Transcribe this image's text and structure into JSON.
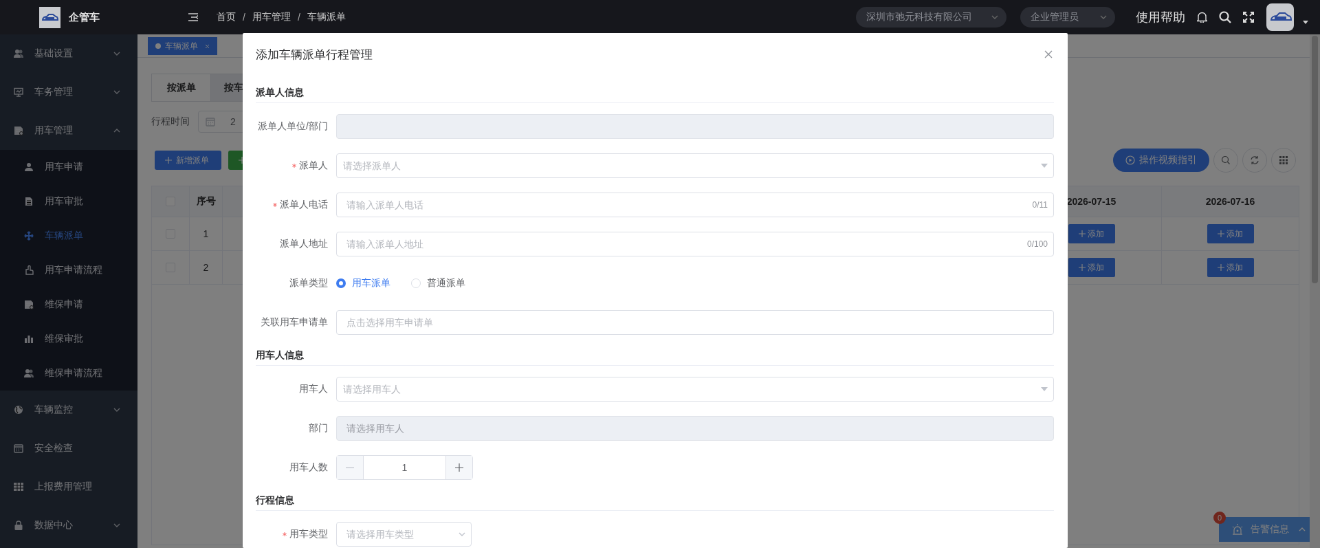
{
  "topbar": {
    "app_name": "企管车",
    "breadcrumb": {
      "separator": "/",
      "items": [
        "首页",
        "用车管理",
        "车辆派单"
      ]
    },
    "company": "深圳市弛元科技有限公司",
    "role": "企业管理员",
    "help": "使用帮助"
  },
  "sidebar": {
    "items": [
      {
        "kind": "group",
        "label": "基础设置",
        "expanded": false
      },
      {
        "kind": "group",
        "label": "车务管理",
        "expanded": false
      },
      {
        "kind": "group",
        "label": "用车管理",
        "expanded": true,
        "children": [
          {
            "label": "用车申请",
            "selected": false
          },
          {
            "label": "用车审批",
            "selected": false
          },
          {
            "label": "车辆派单",
            "selected": true
          },
          {
            "label": "用车申请流程",
            "selected": false
          },
          {
            "label": "维保申请",
            "selected": false
          },
          {
            "label": "维保审批",
            "selected": false
          },
          {
            "label": "维保申请流程",
            "selected": false
          }
        ]
      },
      {
        "kind": "group",
        "label": "车辆监控",
        "expanded": false
      },
      {
        "kind": "link",
        "label": "安全检查"
      },
      {
        "kind": "link",
        "label": "上报费用管理"
      },
      {
        "kind": "group",
        "label": "数据中心",
        "expanded": false
      }
    ]
  },
  "tags": [
    {
      "label": "车辆派单",
      "selected": true
    }
  ],
  "view_tabs": [
    {
      "label": "按派单",
      "selected": true
    },
    {
      "label": "按车",
      "selected": false
    }
  ],
  "filter": {
    "label": "行程时间",
    "value": "2"
  },
  "toolbar": {
    "buttons": [
      {
        "kind": "primary",
        "label": "新增派单"
      },
      {
        "kind": "success"
      }
    ],
    "guide_button": "操作视频指引"
  },
  "table": {
    "columns": [
      {
        "kind": "checkbox",
        "checked": false
      },
      {
        "kind": "text",
        "label": "序号"
      },
      {
        "kind": "date",
        "label": "2026-07-15"
      },
      {
        "kind": "date",
        "label": "2026-07-16"
      }
    ],
    "rows": [
      {
        "checked": false,
        "index": "1",
        "actions": [
          "添加",
          "添加"
        ]
      },
      {
        "checked": false,
        "index": "2",
        "actions": [
          "添加",
          "添加"
        ]
      }
    ]
  },
  "alert": {
    "label": "告警信息",
    "count": "0"
  },
  "dialog": {
    "title": "添加车辆派单行程管理",
    "sections": [
      {
        "title": "派单人信息",
        "fields": [
          {
            "kind": "text",
            "label": "派单人单位/部门",
            "required": false,
            "disabled": true
          },
          {
            "kind": "select",
            "label": "派单人",
            "required": true,
            "placeholder": "请选择派单人"
          },
          {
            "kind": "text",
            "label": "派单人电话",
            "required": true,
            "disabled": false,
            "placeholder": "请输入派单人电话",
            "counter": "0/11"
          },
          {
            "kind": "text",
            "label": "派单人地址",
            "required": false,
            "disabled": false,
            "placeholder": "请输入派单人地址",
            "counter": "0/100"
          },
          {
            "kind": "radio",
            "label": "派单类型",
            "required": false,
            "options": [
              {
                "label": "用车派单",
                "selected": true
              },
              {
                "label": "普通派单",
                "selected": false
              }
            ]
          },
          {
            "kind": "text",
            "label": "关联用车申请单",
            "required": false,
            "disabled": false,
            "placeholder": "点击选择用车申请单"
          }
        ]
      },
      {
        "title": "用车人信息",
        "fields": [
          {
            "kind": "select",
            "label": "用车人",
            "required": false,
            "placeholder": "请选择用车人"
          },
          {
            "kind": "text",
            "label": "部门",
            "required": false,
            "disabled": true,
            "placeholder": "请选择用车人"
          },
          {
            "kind": "number",
            "label": "用车人数",
            "required": false,
            "value": "1",
            "decrease_disabled": true
          }
        ]
      },
      {
        "title": "行程信息",
        "fields": [
          {
            "kind": "short-select",
            "label": "用车类型",
            "required": true,
            "placeholder": "请选择用车类型"
          }
        ]
      }
    ]
  }
}
